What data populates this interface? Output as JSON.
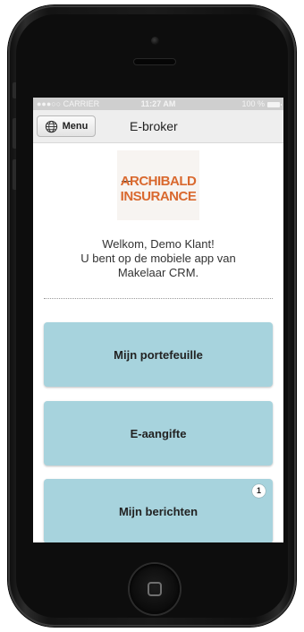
{
  "statusbar": {
    "carrier": "●●●○○ CARRIER",
    "time": "11:27 AM",
    "battery": "100 %"
  },
  "navbar": {
    "menu_label": "Menu",
    "title": "E-broker"
  },
  "logo": {
    "line1": "ARCHIBALD",
    "line2": "INSURANCE"
  },
  "welcome": {
    "line1": "Welkom, Demo Klant!",
    "line2": "U bent op de mobiele app van",
    "line3": "Makelaar CRM."
  },
  "tiles": [
    {
      "label": "Mijn portefeuille"
    },
    {
      "label": "E-aangifte"
    },
    {
      "label": "Mijn berichten",
      "badge": "1"
    }
  ],
  "colors": {
    "tile": "#a7d3dd",
    "logo_orange": "#d9692f",
    "navbar": "#eeeeee",
    "phone_body": "#1b1b1b"
  }
}
